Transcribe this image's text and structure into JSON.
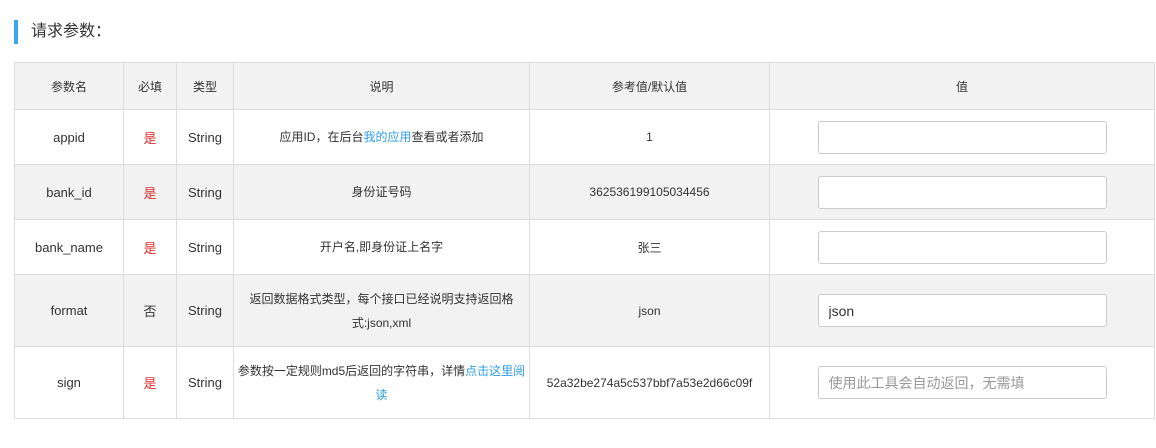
{
  "section": {
    "title": "请求参数："
  },
  "table": {
    "headers": {
      "name": "参数名",
      "required": "必填",
      "type": "类型",
      "desc": "说明",
      "ref": "参考值/默认值",
      "value": "值"
    },
    "rows": [
      {
        "name": "appid",
        "required": "是",
        "type": "String",
        "desc_before": "应用ID，在后台",
        "desc_link": "我的应用",
        "desc_after": "查看或者添加",
        "ref": "1",
        "value": "",
        "placeholder": ""
      },
      {
        "name": "bank_id",
        "required": "是",
        "type": "String",
        "desc_before": "身份证号码",
        "desc_link": "",
        "desc_after": "",
        "ref": "362536199105034456",
        "value": "",
        "placeholder": ""
      },
      {
        "name": "bank_name",
        "required": "是",
        "type": "String",
        "desc_before": "开户名,即身份证上名字",
        "desc_link": "",
        "desc_after": "",
        "ref": "张三",
        "value": "",
        "placeholder": ""
      },
      {
        "name": "format",
        "required": "否",
        "type": "String",
        "desc_before": "返回数据格式类型，每个接口已经说明支持返回格式:json,xml",
        "desc_link": "",
        "desc_after": "",
        "ref": "json",
        "value": "json",
        "placeholder": ""
      },
      {
        "name": "sign",
        "required": "是",
        "type": "String",
        "desc_before": "参数按一定规则md5后返回的字符串，详情",
        "desc_link": "点击这里阅读",
        "desc_after": "",
        "ref": "52a32be274a5c537bbf7a53e2d66c09f",
        "value": "",
        "placeholder": "使用此工具会自动返回，无需填"
      }
    ]
  },
  "colors": {
    "accent": "#3aa7f0",
    "link": "#2f9ee8",
    "required": "#e02d2d",
    "header_bg": "#f2f2f2",
    "border": "#dddddd"
  }
}
